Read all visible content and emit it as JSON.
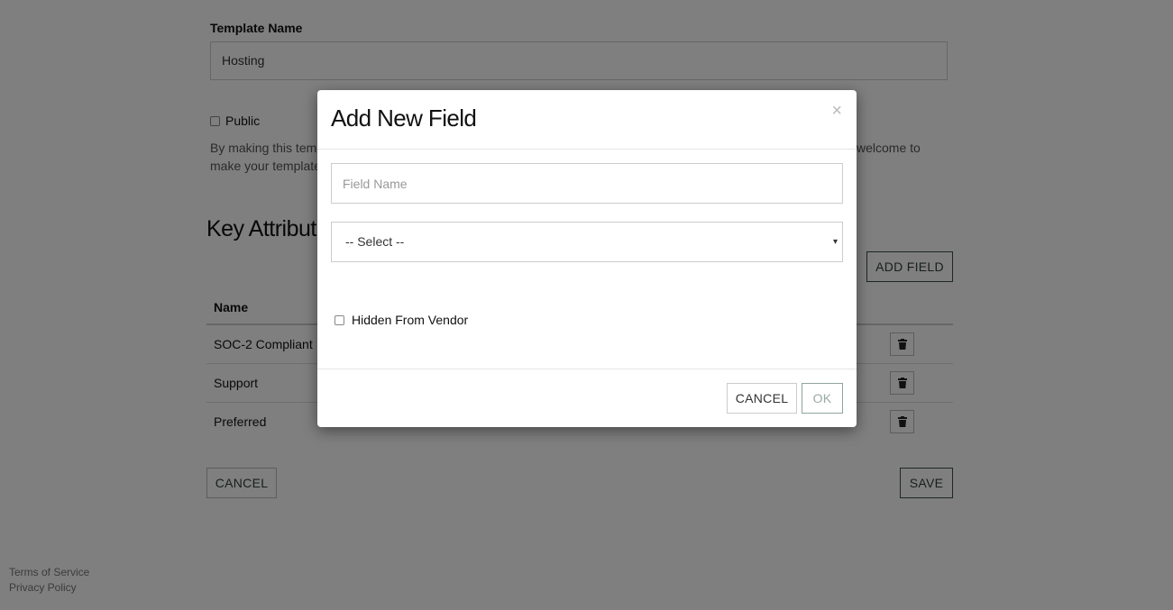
{
  "form": {
    "template_name_label": "Template Name",
    "template_name_value": "Hosting",
    "public_label": "Public",
    "description_line1": "By making this tem",
    "description_line1_end": "welcome to",
    "description_line2": "make your template"
  },
  "key_attributes": {
    "heading": "Key Attributes",
    "add_field_label": "ADD FIELD",
    "column_name": "Name",
    "rows": [
      {
        "name": "SOC-2 Compliant"
      },
      {
        "name": "Support"
      },
      {
        "name": "Preferred"
      }
    ]
  },
  "actions": {
    "cancel_label": "CANCEL",
    "save_label": "SAVE"
  },
  "footer": {
    "terms": "Terms of Service",
    "privacy": "Privacy Policy"
  },
  "modal": {
    "title": "Add New Field",
    "close_glyph": "×",
    "field_name_placeholder": "Field Name",
    "select_value": "-- Select --",
    "caret_glyph": "▾",
    "hidden_label": "Hidden From Vendor",
    "cancel_label": "CANCEL",
    "ok_label": "OK"
  },
  "icons": {
    "trash": "trash-icon",
    "close": "close-icon",
    "caret": "chevron-down-icon"
  },
  "colors": {
    "accent": "#3c4f4a",
    "overlay": "rgba(0,0,0,0.5)"
  }
}
